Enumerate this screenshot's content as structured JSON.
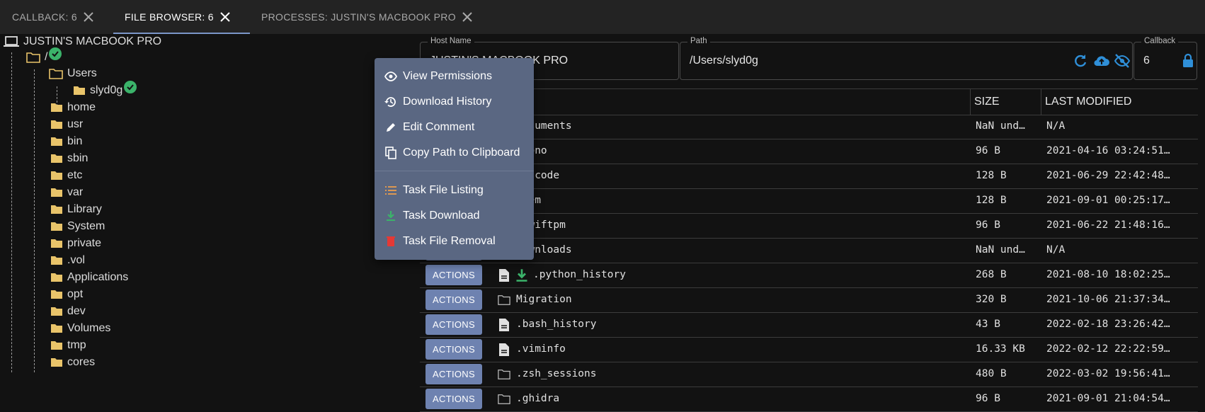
{
  "tabs": [
    {
      "label": "CALLBACK: 6"
    },
    {
      "label": "FILE BROWSER: 6"
    },
    {
      "label": "PROCESSES: JUSTIN'S MACBOOK PRO"
    }
  ],
  "tree": {
    "root": "JUSTIN'S MACBOOK PRO",
    "slash": "/",
    "users": "Users",
    "user": "slyd0g",
    "dirs": [
      "home",
      "usr",
      "bin",
      "sbin",
      "etc",
      "var",
      "Library",
      "System",
      "private",
      ".vol",
      "Applications",
      "opt",
      "dev",
      "Volumes",
      "tmp",
      "cores"
    ]
  },
  "fields": {
    "host_label": "Host Name",
    "host_value": "JUSTIN'S MACBOOK PRO",
    "path_label": "Path",
    "path_value": "/Users/slyd0g",
    "callback_label": "Callback",
    "callback_value": "6"
  },
  "table": {
    "headers": {
      "size": "SIZE",
      "modified": "LAST MODIFIED"
    },
    "action_label": "ACTIONS",
    "rows": [
      {
        "name": "Documents",
        "size": "NaN und…",
        "modified": "N/A",
        "type": "folder"
      },
      {
        "name": ".mono",
        "size": "96 B",
        "modified": "2021-04-16 03:24:51…",
        "type": "folder"
      },
      {
        "name": ".vscode",
        "size": "128 B",
        "modified": "2021-06-29 22:42:48…",
        "type": "folder"
      },
      {
        "name": ".gem",
        "size": "128 B",
        "modified": "2021-09-01 00:25:17…",
        "type": "folder"
      },
      {
        "name": ".swiftpm",
        "size": "96 B",
        "modified": "2021-06-22 21:48:16…",
        "type": "folder"
      },
      {
        "name": "Downloads",
        "size": "NaN und…",
        "modified": "N/A",
        "type": "folder"
      },
      {
        "name": ".python_history",
        "size": "268 B",
        "modified": "2021-08-10 18:02:25…",
        "type": "file-downloaded"
      },
      {
        "name": "Migration",
        "size": "320 B",
        "modified": "2021-10-06 21:37:34…",
        "type": "folder"
      },
      {
        "name": ".bash_history",
        "size": "43 B",
        "modified": "2022-02-18 23:26:42…",
        "type": "file"
      },
      {
        "name": ".viminfo",
        "size": "16.33 KB",
        "modified": "2022-02-12 22:22:59…",
        "type": "file"
      },
      {
        "name": ".zsh_sessions",
        "size": "480 B",
        "modified": "2022-03-02 19:56:41…",
        "type": "folder"
      },
      {
        "name": ".ghidra",
        "size": "96 B",
        "modified": "2021-09-01 21:04:54…",
        "type": "folder"
      }
    ]
  },
  "menu": {
    "items": [
      {
        "label": "View Permissions",
        "icon": "eye-icon"
      },
      {
        "label": "Download History",
        "icon": "history-icon"
      },
      {
        "label": "Edit Comment",
        "icon": "pencil-icon"
      },
      {
        "label": "Copy Path to Clipboard",
        "icon": "copy-icon"
      },
      {
        "label": "Task File Listing",
        "icon": "list-icon"
      },
      {
        "label": "Task Download",
        "icon": "download-icon"
      },
      {
        "label": "Task File Removal",
        "icon": "trash-icon"
      }
    ]
  },
  "colors": {
    "accent": "#7b96c8",
    "action_button": "#6e82b0",
    "success": "#3bb36a",
    "icon_blue": "#2f8fd8",
    "menu_bg": "#5a6782"
  }
}
